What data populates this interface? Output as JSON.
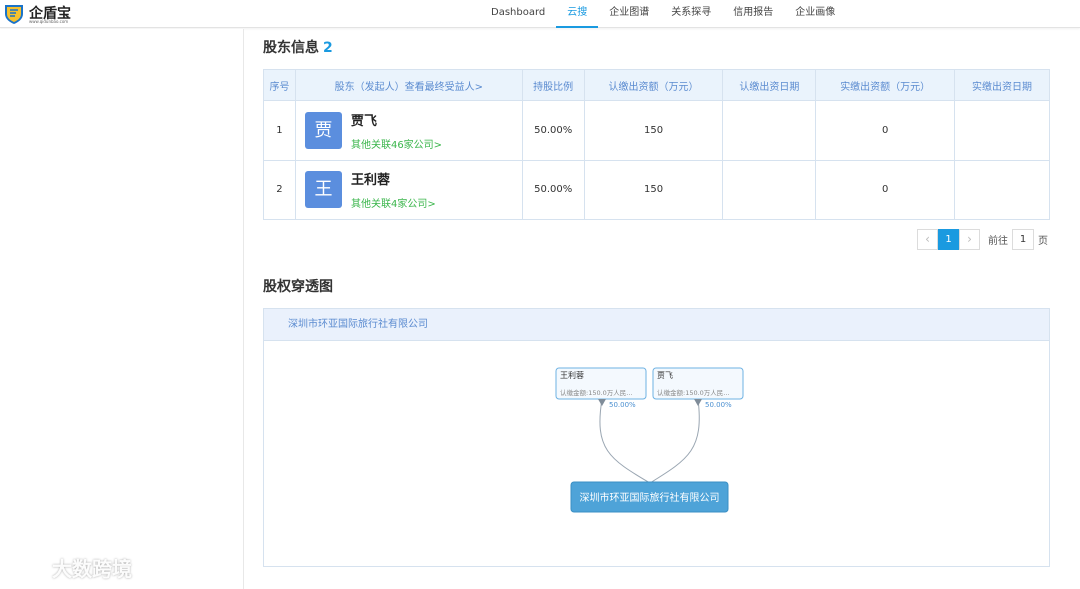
{
  "header": {
    "brand": "企盾宝",
    "brand_url": "www.qidunbao.com",
    "tabs": [
      {
        "label": "Dashboard",
        "active": false
      },
      {
        "label": "云搜",
        "active": true
      },
      {
        "label": "企业图谱",
        "active": false
      },
      {
        "label": "关系探寻",
        "active": false
      },
      {
        "label": "信用报告",
        "active": false
      },
      {
        "label": "企业画像",
        "active": false
      }
    ]
  },
  "shareholders": {
    "title": "股东信息",
    "count": "2",
    "columns": [
      "序号",
      "股东（发起人）查看最终受益人>",
      "持股比例",
      "认缴出资额（万元）",
      "认缴出资日期",
      "实缴出资额（万元）",
      "实缴出资日期"
    ],
    "rows": [
      {
        "index": "1",
        "avatar": "贾",
        "name": "贾飞",
        "related": "其他关联46家公司>",
        "ratio": "50.00%",
        "subscribed": "150",
        "subscribed_date": "",
        "paid": "0",
        "paid_date": ""
      },
      {
        "index": "2",
        "avatar": "王",
        "name": "王利蓉",
        "related": "其他关联4家公司>",
        "ratio": "50.00%",
        "subscribed": "150",
        "subscribed_date": "",
        "paid": "0",
        "paid_date": ""
      }
    ]
  },
  "pagination": {
    "current": "1",
    "goto_label": "前往",
    "goto_value": "1",
    "page_label": "页"
  },
  "equity": {
    "title": "股权穿透图",
    "company": "深圳市环亚国际旅行社有限公司",
    "nodes": [
      {
        "name": "王利蓉",
        "detail": "认缴金额:150.0万人民...",
        "ratio": "50.00%"
      },
      {
        "name": "贾飞",
        "detail": "认缴金额:150.0万人民...",
        "ratio": "50.00%"
      }
    ],
    "target": "深圳市环亚国际旅行社有限公司"
  },
  "watermark": "大数跨境",
  "colors": {
    "accent": "#1a9ae0",
    "avatar": "#5b8ede",
    "link_green": "#39b54a",
    "node_fill": "#4ea3d8"
  }
}
